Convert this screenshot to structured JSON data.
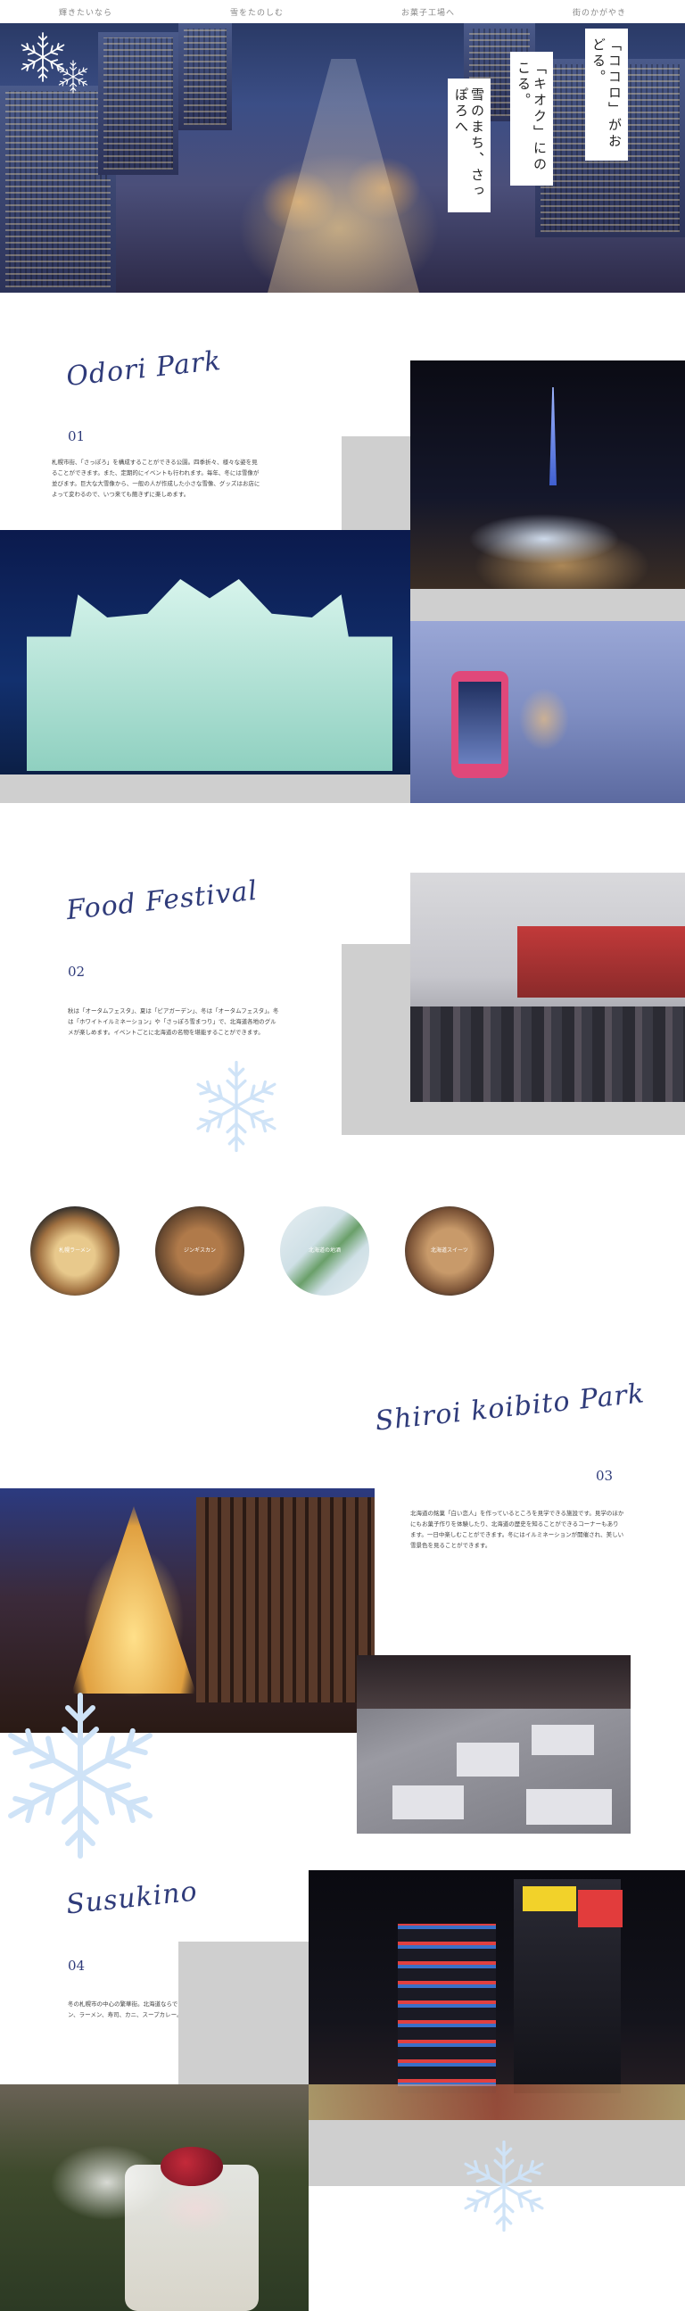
{
  "nav": {
    "items": [
      "輝きたいなら",
      "雪をたのしむ",
      "お菓子工場へ",
      "街のかがやき"
    ]
  },
  "hero": {
    "vertical_lines": [
      "雪のまち、さっぽろへ",
      "「キオク」にのこる。",
      "「ココロ」がおどる。"
    ]
  },
  "sections": {
    "odori": {
      "title": "Odori Park",
      "number": "01",
      "text": "札幌市街、「さっぽろ」を構成することができる公園。四季折々、様々な姿を見ることができます。また、定期的にイベントも行われます。毎年、冬には雪像が並びます。巨大な大雪像から、一般の人が作成した小さな雪像、グッズはお店によって変わるので、いつ来ても飽きずに楽しめます。"
    },
    "food": {
      "title": "Food Festival",
      "number": "02",
      "text": "秋は「オータムフェスタ」、夏は「ビアガーデン」、冬は「オータムフェスタ」。冬は「ホワイトイルミネーション」や「さっぽろ雪まつり」で、北海道各地のグルメが楽しめます。イベントごとに北海道の名物を堪能することができます。",
      "circles": [
        "札幌ラーメン",
        "ジンギスカン",
        "北海道の地酒",
        "北海道スイーツ"
      ]
    },
    "shiroi": {
      "title": "Shiroi koibito Park",
      "number": "03",
      "text": "北海道の銘菓「白い恋人」を作っているところを見学できる施設です。見学のほかにもお菓子作りを体験したり、北海道の歴史を知ることができるコーナーもあります。一日中楽しむことができます。冬にはイルミネーションが開催され、美しい雪景色を見ることができます。"
    },
    "susukino": {
      "title": "Susukino",
      "number": "04",
      "text": "冬の札幌市の中心の繁華街。北海道ならではのグルメが楽しめます。ジンギスカン、ラーメン、寿司、カニ、スープカレー。札幌の夜景は「ススキノ」です。"
    }
  },
  "colors": {
    "accent": "#2f3b7a",
    "gray_block": "#cfcfcf",
    "snowflake": "#cfe3f7"
  }
}
